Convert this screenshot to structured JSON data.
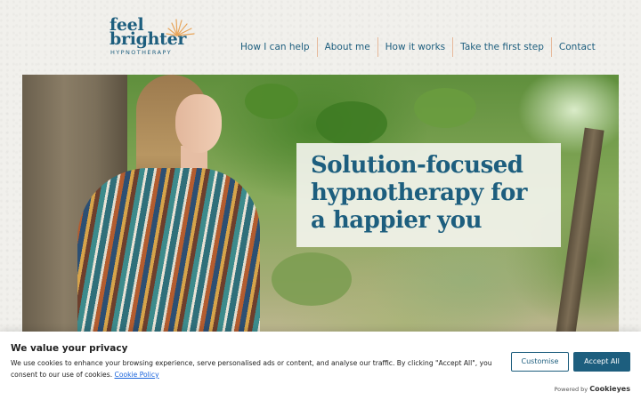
{
  "logo": {
    "line1": "feel",
    "line2": "brighter",
    "subtitle": "HYPNOTHERAPY",
    "colors": {
      "text": "#1d5e7e",
      "sun": "#e8a55a"
    }
  },
  "nav": {
    "items": [
      {
        "label": "How I can help"
      },
      {
        "label": "About me"
      },
      {
        "label": "How it works"
      },
      {
        "label": "Take the first step"
      },
      {
        "label": "Contact"
      }
    ]
  },
  "hero": {
    "title": "Solution-focused hypnotherapy for a happier you"
  },
  "cookie_banner": {
    "title": "We value your privacy",
    "text": "We use cookies to enhance your browsing experience, serve personalised ads or content, and analyse our traffic. By clicking \"Accept All\", you consent to our use of cookies. ",
    "policy_link": "Cookie Policy",
    "customise_label": "Customise",
    "accept_label": "Accept All",
    "powered_by": "Powered by",
    "brand": "Cookieyes"
  },
  "colors": {
    "accent": "#1d5e7e",
    "nav_divider": "#e6b89a",
    "link": "#1863dc"
  }
}
